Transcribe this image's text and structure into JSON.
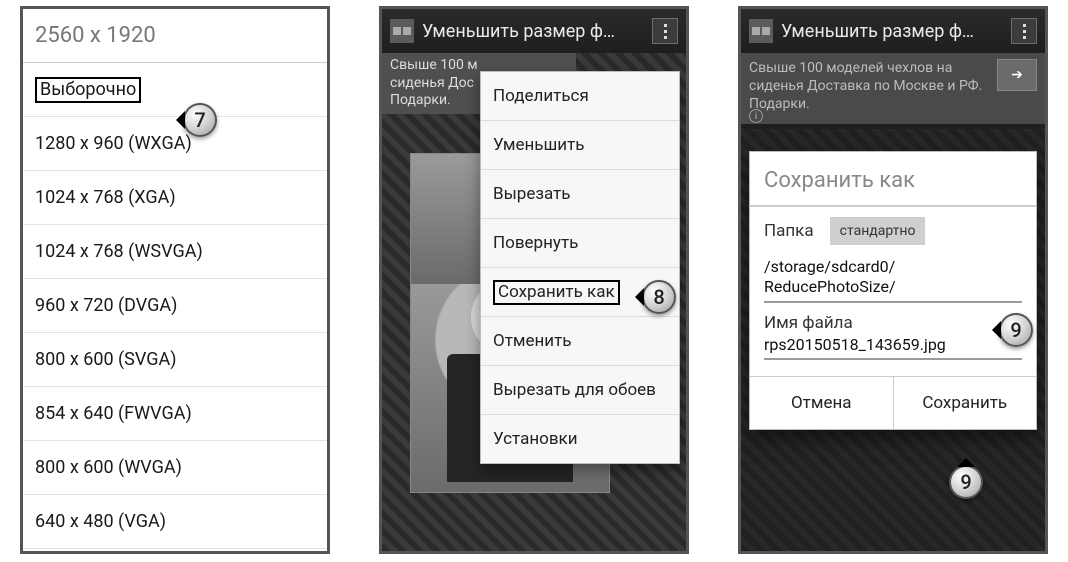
{
  "callouts": {
    "c7": "7",
    "c8": "8",
    "c9a": "9",
    "c9b": "9"
  },
  "screen1": {
    "title": "2560 x 1920",
    "items": [
      "Выборочно",
      "1280 x 960 (WXGA)",
      "1024 x 768 (XGA)",
      "1024 x 768 (WSVGA)",
      "960 x 720 (DVGA)",
      "800 x 600 (SVGA)",
      "854 x 640 (FWVGA)",
      "800 x 600 (WVGA)",
      "640 x 480 (VGA)"
    ]
  },
  "screen2": {
    "appbar_title": "Уменьшить размер ф…",
    "ad_text": "Свыше 100 м\nсиденья Дос\nПодарки.",
    "menu": [
      "Поделиться",
      "Уменьшить",
      "Вырезать",
      "Повернуть",
      "Сохранить как",
      "Отменить",
      "Вырезать для обоев",
      "Установки"
    ]
  },
  "screen3": {
    "appbar_title": "Уменьшить размер ф…",
    "ad_text": "Свыше 100 моделей чехлов на\nсиденья Доставка по Москве и РФ.\nПодарки.",
    "dialog": {
      "title": "Сохранить как",
      "folder_label": "Папка",
      "folder_chip": "стандартно",
      "folder_path": "/storage/sdcard0/\nReducePhotoSize/",
      "filename_label": "Имя файла",
      "filename_value": "rps20150518_143659.jpg",
      "cancel": "Отмена",
      "save": "Сохранить"
    }
  }
}
